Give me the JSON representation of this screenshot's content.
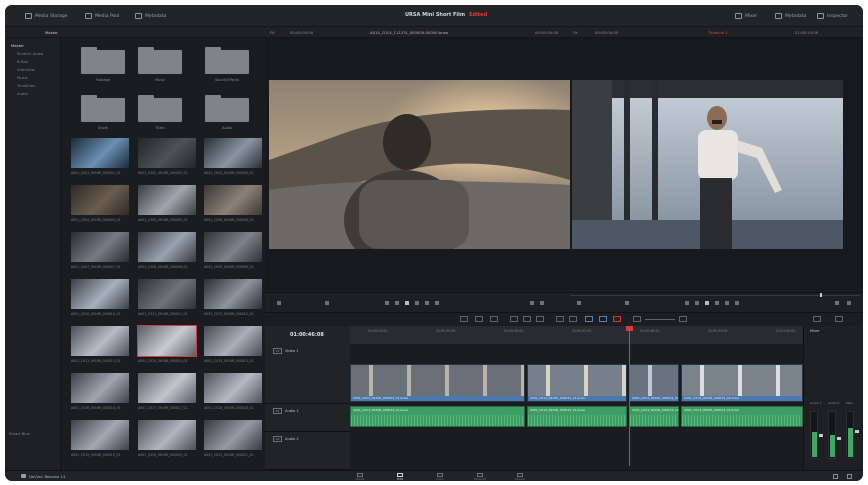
{
  "topbar": {
    "media_storage": "Media Storage",
    "media_pool": "Media Pool",
    "metadata": "Metadata",
    "project_title": "URSA Mini Short Film",
    "edited_badge": "Edited",
    "mixer": "Mixer",
    "metadata_right": "Metadata",
    "inspector": "Inspector"
  },
  "subbar": {
    "master": "Master",
    "fit": "Fit",
    "clip_name": "A014_C014_11123L_000000-00000.braw",
    "timecode_left": "00:00:00:00",
    "fit_right": "Fit",
    "timeline_name": "Timeline 1",
    "timecode_right": "01:00:15:09"
  },
  "sidebar": {
    "items": [
      {
        "label": "Master",
        "active": true
      },
      {
        "label": "Scratch Audio"
      },
      {
        "label": "B-Roll"
      },
      {
        "label": "Interview"
      },
      {
        "label": "Music"
      },
      {
        "label": "Timelines"
      },
      {
        "label": "Audio"
      }
    ],
    "smart_bins": "Smart Bins"
  },
  "media_pool": {
    "folders": [
      "Footage",
      "Music",
      "Sound Effects",
      "Shots",
      "Titles",
      "Audio"
    ],
    "clips": [
      "A001_C001_0916R_000001_01",
      "A001_C002_0916R_000002_01",
      "A001_C003_0916R_000003_01",
      "A001_C004_0916R_000004_01",
      "A001_C005_0916R_000005_01",
      "A001_C006_0916R_000006_01",
      "A001_C007_0916R_000007_01",
      "A001_C008_0916R_000008_01",
      "A001_C009_0916R_000009_01",
      "A001_C010_0916R_000010_01",
      "A001_C011_0916R_000011_01",
      "A001_C012_0916R_000012_01",
      "A001_C013_0916R_000013_01",
      "A001_C014_0916R_000014_01",
      "A001_C015_0916R_000015_01",
      "A001_C016_0916R_000016_01",
      "A001_C017_0916R_000017_01",
      "A001_C018_0916R_000018_01",
      "A001_C019_0916R_000019_01",
      "A001_C020_0916R_000020_01",
      "A001_C021_0916R_000021_01"
    ]
  },
  "timeline": {
    "timecode": "01:00:46:08",
    "ruler": [
      "01:00:24:00",
      "01:00:30:00",
      "01:00:36:00",
      "01:00:42:00",
      "01:00:48:00",
      "01:00:54:00",
      "01:01:00:00"
    ],
    "tracks": {
      "video": {
        "tag": "V1",
        "name": "Video 1"
      },
      "audio1": {
        "tag": "A1",
        "name": "Audio 1"
      },
      "audio2": {
        "tag": "A2",
        "name": "Audio 2"
      }
    },
    "video_clip_label": "A001_C014_0916R_000014_01.braw",
    "audio_clip_label": "A001_C014_0916R_000014_01.braw"
  },
  "mixer": {
    "title": "Mixer",
    "channels": [
      "Audio 1",
      "Audio 2",
      "Main"
    ],
    "levels": [
      0.55,
      0.48,
      0.62
    ]
  },
  "pages": [
    {
      "label": "Media"
    },
    {
      "label": "Edit",
      "active": true
    },
    {
      "label": "Color"
    },
    {
      "label": "Fairlight"
    },
    {
      "label": "Deliver"
    }
  ],
  "app_name": "DaVinci Resolve 14",
  "colors": {
    "accent_red": "#e0383b",
    "video_blue": "#4a79b0",
    "audio_green": "#3e9d63"
  }
}
